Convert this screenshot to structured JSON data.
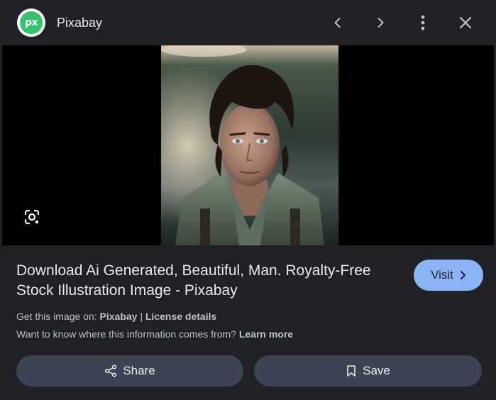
{
  "header": {
    "logo_text": "px",
    "logo_color": "#2ec66d",
    "site_name": "Pixabay",
    "buttons": [
      "chevron-left-icon",
      "chevron-right-icon",
      "more-vert-icon",
      "close-icon"
    ]
  },
  "image": {
    "subject": "portrait",
    "lens_icon": "google-lens-icon"
  },
  "info": {
    "title": "Download Ai Generated, Beautiful, Man. Royalty-Free Stock Illustration Image - Pixabay",
    "visit_label": "Visit",
    "get_image_prefix": "Get this image on:",
    "source_link": "Pixabay",
    "separator": "|",
    "license_link": "License details",
    "info_prefix": "Want to know where this information comes from?",
    "learn_more": "Learn more"
  },
  "actions": {
    "share_label": "Share",
    "save_label": "Save"
  },
  "colors": {
    "background": "#202124",
    "accent": "#8ab4f8",
    "pill": "#3c4453"
  }
}
